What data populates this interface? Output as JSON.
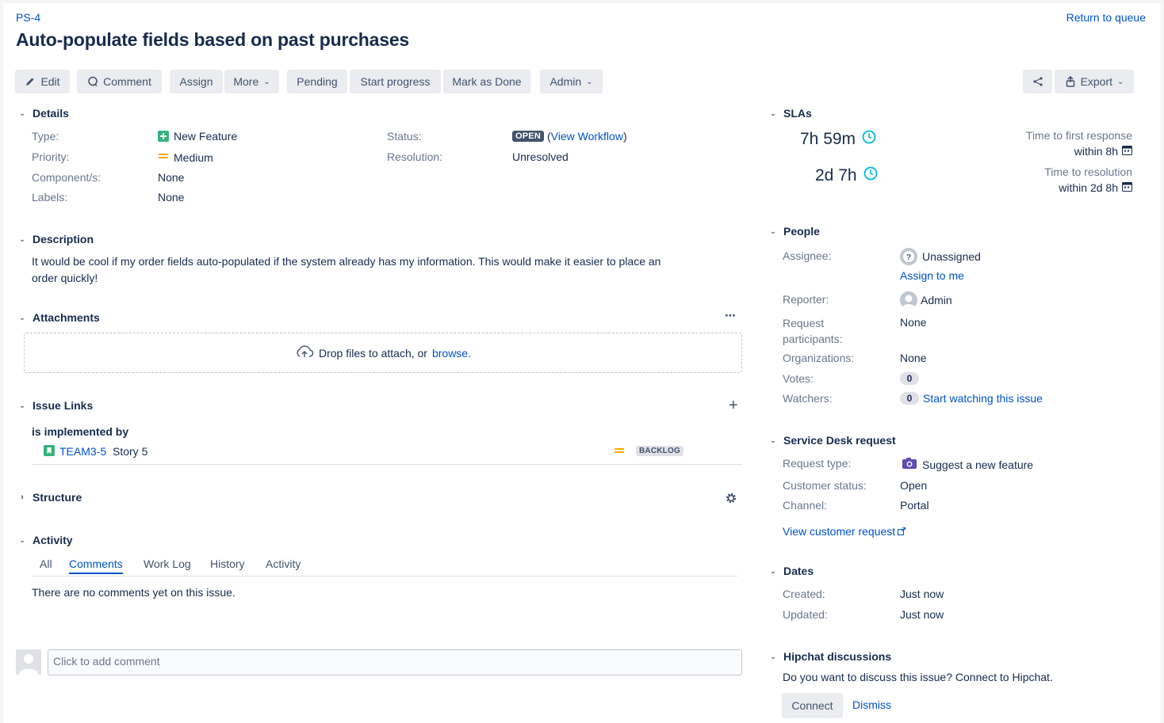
{
  "header": {
    "issue_key": "PS-4",
    "summary": "Auto-populate fields based on past purchases",
    "return_link": "Return to queue"
  },
  "toolbar": {
    "edit": "Edit",
    "comment": "Comment",
    "assign": "Assign",
    "more": "More",
    "pending": "Pending",
    "start_progress": "Start progress",
    "mark_done": "Mark as Done",
    "admin": "Admin",
    "export": "Export"
  },
  "details": {
    "title": "Details",
    "type_label": "Type:",
    "type_value": "New Feature",
    "priority_label": "Priority:",
    "priority_value": "Medium",
    "components_label": "Component/s:",
    "components_value": "None",
    "labels_label": "Labels:",
    "labels_value": "None",
    "status_label": "Status:",
    "status_value": "OPEN",
    "view_workflow": "View Workflow",
    "resolution_label": "Resolution:",
    "resolution_value": "Unresolved"
  },
  "description": {
    "title": "Description",
    "text_line1": "It would be cool if my order fields auto-populated if the system already has my information. This would make it easier to place an",
    "text_line2": "order quickly!"
  },
  "attachments": {
    "title": "Attachments",
    "drop_text": "Drop files to attach, or",
    "browse": "browse."
  },
  "issue_links": {
    "title": "Issue Links",
    "relation": "is implemented by",
    "link_key": "TEAM3-5",
    "link_summary": "Story 5",
    "link_status": "BACKLOG"
  },
  "structure": {
    "title": "Structure"
  },
  "activity": {
    "title": "Activity",
    "tabs": [
      "All",
      "Comments",
      "Work Log",
      "History",
      "Activity"
    ],
    "active_tab": "Comments",
    "empty_text": "There are no comments yet on this issue.",
    "comment_placeholder": "Click to add comment"
  },
  "slas": {
    "title": "SLAs",
    "items": [
      {
        "time": "7h 59m",
        "label": "Time to first response",
        "goal": "within 8h"
      },
      {
        "time": "2d 7h",
        "label": "Time to resolution",
        "goal": "within 2d 8h"
      }
    ]
  },
  "people": {
    "title": "People",
    "assignee_label": "Assignee:",
    "assignee_value": "Unassigned",
    "assign_to_me": "Assign to me",
    "reporter_label": "Reporter:",
    "reporter_value": "Admin",
    "participants_label_1": "Request",
    "participants_label_2": "participants:",
    "participants_value": "None",
    "organizations_label": "Organizations:",
    "organizations_value": "None",
    "votes_label": "Votes:",
    "votes_value": "0",
    "watchers_label": "Watchers:",
    "watchers_value": "0",
    "start_watching": "Start watching this issue"
  },
  "service_desk": {
    "title": "Service Desk request",
    "request_type_label": "Request type:",
    "request_type_value": "Suggest a new feature",
    "customer_status_label": "Customer status:",
    "customer_status_value": "Open",
    "channel_label": "Channel:",
    "channel_value": "Portal",
    "view_customer_request": "View customer request"
  },
  "dates": {
    "title": "Dates",
    "created_label": "Created:",
    "created_value": "Just now",
    "updated_label": "Updated:",
    "updated_value": "Just now"
  },
  "hipchat": {
    "title": "Hipchat discussions",
    "prompt": "Do you want to discuss this issue? Connect to Hipchat.",
    "connect": "Connect",
    "dismiss": "Dismiss"
  },
  "colors": {
    "link": "#0052cc",
    "feature_green": "#36b37e",
    "priority_medium": "#ffab00",
    "sla_clock": "#00b8d9",
    "story_green": "#36b37e"
  }
}
